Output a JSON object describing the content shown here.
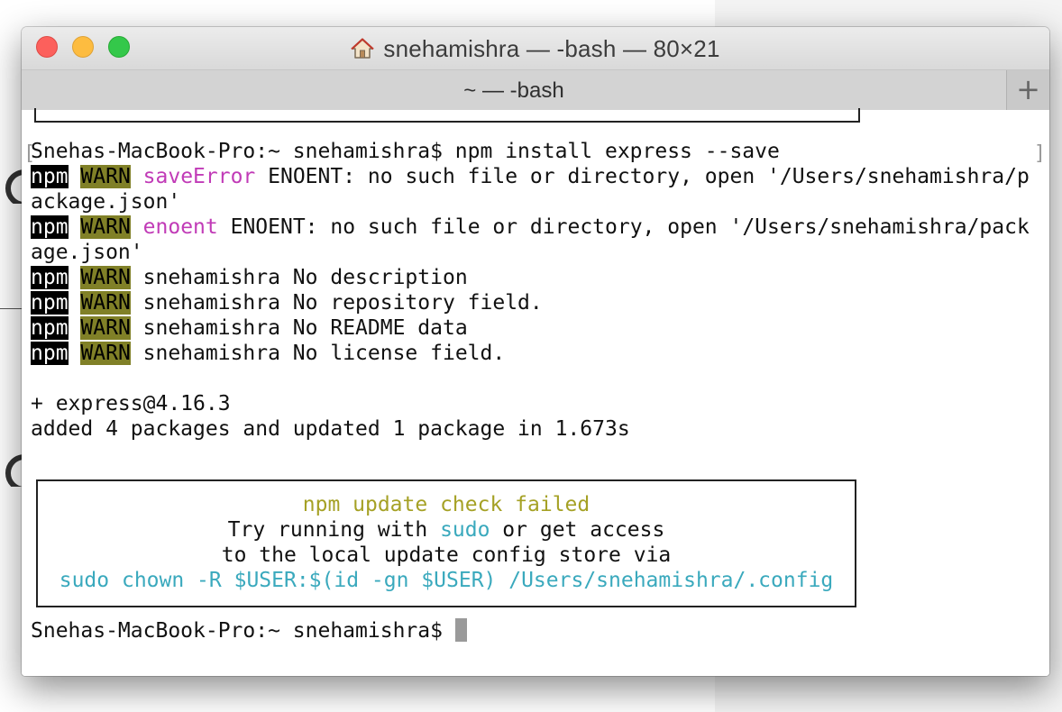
{
  "window": {
    "title": "snehamishra — -bash — 80×21",
    "title_icon": "home-icon"
  },
  "tab": {
    "label": "~ — -bash",
    "add_label": "+"
  },
  "terminal": {
    "command_prompt": "Snehas-MacBook-Pro:~ snehamishra$ npm install express --save",
    "warn1": {
      "npm": "npm",
      "warn": "WARN",
      "kind": "saveError",
      "text": " ENOENT: no such file or directory, open '/Users/snehamishra/p",
      "cont": "ackage.json'"
    },
    "warn2": {
      "npm": "npm",
      "warn": "WARN",
      "kind": "enoent",
      "text": " ENOENT: no such file or directory, open '/Users/snehamishra/pack",
      "cont": "age.json'"
    },
    "warn3": {
      "npm": "npm",
      "warn": "WARN",
      "text": " snehamishra No description"
    },
    "warn4": {
      "npm": "npm",
      "warn": "WARN",
      "text": " snehamishra No repository field."
    },
    "warn5": {
      "npm": "npm",
      "warn": "WARN",
      "text": " snehamishra No README data"
    },
    "warn6": {
      "npm": "npm",
      "warn": "WARN",
      "text": " snehamishra No license field."
    },
    "installed": "+ express@4.16.3",
    "summary": "added 4 packages and updated 1 package in 1.673s",
    "box": {
      "line1": "npm update check failed",
      "line2_a": "Try running with ",
      "line2_b": "sudo",
      "line2_c": " or get access",
      "line3": "to the local update config store via",
      "line4": "sudo chown -R $USER:$(id -gn $USER) /Users/snehamishra/.config"
    },
    "final_prompt": "Snehas-MacBook-Pro:~ snehamishra$ "
  },
  "colors": {
    "npm_tag_bg": "#000000",
    "warn_tag_bg": "#808027",
    "magenta": "#c13bb7",
    "yellow": "#a5a125",
    "cyan": "#3aa9bd"
  }
}
